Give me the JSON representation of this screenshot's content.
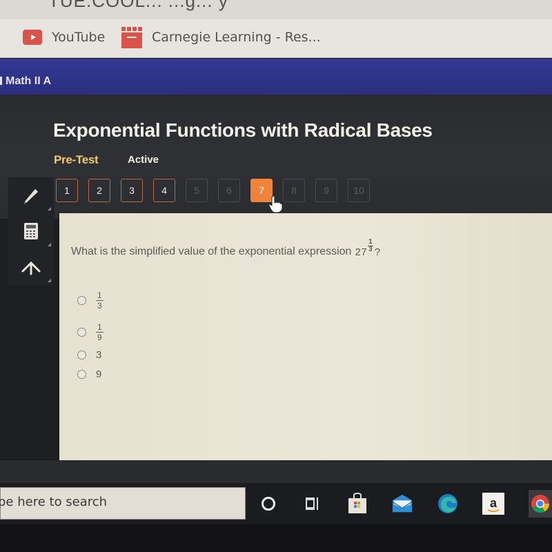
{
  "browser": {
    "url_fragment": "TUE.COOL... ...g... y",
    "bookmarks": [
      {
        "label": "YouTube",
        "icon": "youtube-icon"
      },
      {
        "label": "Carnegie Learning - Res...",
        "icon": "clapperboard-icon"
      }
    ]
  },
  "course": {
    "name": "Math II A"
  },
  "assessment": {
    "title": "Exponential Functions with Radical Bases",
    "type": "Pre-Test",
    "status": "Active",
    "questions": [
      {
        "label": "1",
        "state": "answered"
      },
      {
        "label": "2",
        "state": "answered"
      },
      {
        "label": "3",
        "state": "answered"
      },
      {
        "label": "4",
        "state": "answered"
      },
      {
        "label": "5",
        "state": "locked"
      },
      {
        "label": "6",
        "state": "locked"
      },
      {
        "label": "7",
        "state": "current"
      },
      {
        "label": "8",
        "state": "locked"
      },
      {
        "label": "9",
        "state": "locked"
      },
      {
        "label": "10",
        "state": "locked"
      }
    ],
    "current_question": 7,
    "colors": {
      "accent": "#f0833c",
      "pretest_label": "#f1c874",
      "course_band": "#2e3286"
    }
  },
  "tools": [
    {
      "name": "pencil-tool",
      "icon": "pencil-icon"
    },
    {
      "name": "calculator-tool",
      "icon": "calculator-icon"
    },
    {
      "name": "reference-tool",
      "icon": "arrow-up-icon"
    }
  ],
  "question": {
    "prompt": "What is the simplified value of the exponential expression",
    "base": "27",
    "exponent_numerator": "1",
    "exponent_denominator": "3",
    "suffix": "?",
    "options": [
      {
        "type": "fraction",
        "numerator": "1",
        "denominator": "3",
        "selected": false
      },
      {
        "type": "fraction",
        "numerator": "1",
        "denominator": "9",
        "selected": false
      },
      {
        "type": "text",
        "text": "3",
        "selected": false
      },
      {
        "type": "text",
        "text": "9",
        "selected": false
      }
    ]
  },
  "taskbar": {
    "search_placeholder": "Type here to search",
    "search_visible_text": "pe here to search",
    "icons": [
      "cortana-icon",
      "task-view-icon",
      "store-icon",
      "mail-icon",
      "edge-icon",
      "amazon-icon",
      "chrome-icon"
    ]
  }
}
